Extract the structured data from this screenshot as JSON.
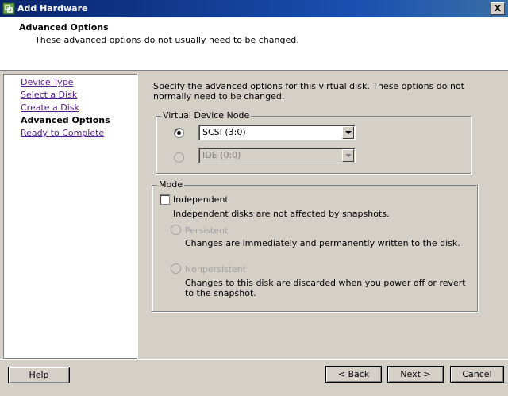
{
  "window": {
    "title": "Add Hardware",
    "close_glyph": "X"
  },
  "header": {
    "title": "Advanced Options",
    "subtitle": "These advanced options do not usually need to be changed."
  },
  "sidebar": {
    "items": [
      {
        "label": "Device Type",
        "state": "link"
      },
      {
        "label": "Select a Disk",
        "state": "link"
      },
      {
        "label": "Create a Disk",
        "state": "link"
      },
      {
        "label": "Advanced Options",
        "state": "current"
      },
      {
        "label": "Ready to Complete",
        "state": "link"
      }
    ]
  },
  "main": {
    "intro": "Specify the advanced options for this virtual disk. These options do not normally need to be changed.",
    "virtual_device_node": {
      "legend": "Virtual Device Node",
      "scsi": {
        "value": "SCSI (3:0)",
        "selected": true
      },
      "ide": {
        "value": "IDE (0:0)",
        "selected": false,
        "disabled": true
      }
    },
    "mode": {
      "legend": "Mode",
      "independent": {
        "label": "Independent",
        "checked": false
      },
      "independent_desc": "Independent disks are not affected by snapshots.",
      "persistent": {
        "label": "Persistent",
        "desc": "Changes are immediately and permanently written to the disk."
      },
      "nonpersistent": {
        "label": "Nonpersistent",
        "desc": "Changes to this disk are discarded when you power off or revert to the snapshot."
      }
    }
  },
  "footer": {
    "help": "Help",
    "back": "< Back",
    "next": "Next >",
    "cancel": "Cancel"
  },
  "colors": {
    "titlebar": "#0a246a",
    "dialog": "#d4d0c8",
    "link": "#551a8b"
  }
}
